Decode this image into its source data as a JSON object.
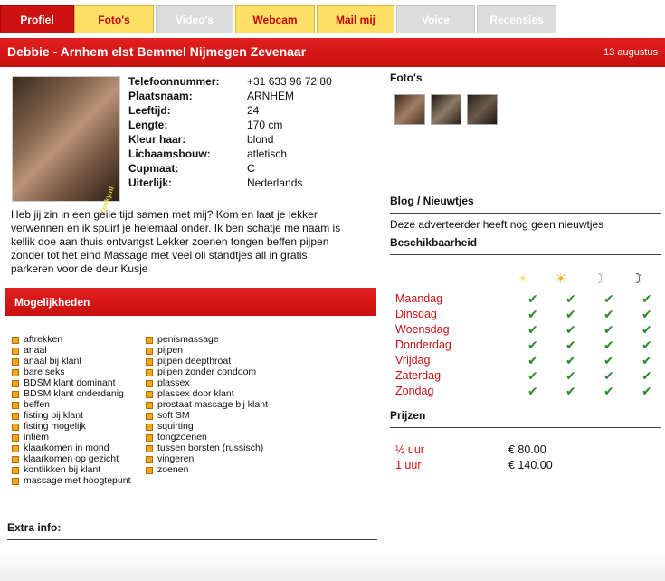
{
  "tabs": [
    {
      "label": "Profiel",
      "state": "active"
    },
    {
      "label": "Foto's",
      "state": "enabled"
    },
    {
      "label": "Video's",
      "state": "disabled"
    },
    {
      "label": "Webcam",
      "state": "enabled"
    },
    {
      "label": "Mail mij",
      "state": "enabled"
    },
    {
      "label": "Voice",
      "state": "disabled"
    },
    {
      "label": "Recensies",
      "state": "disabled"
    }
  ],
  "header": {
    "title": "Debbie - Arnhem elst Bemmel Nijmegen Zevenaar",
    "date": "13 augustus"
  },
  "photo": {
    "watermark": "Zoeky.nl"
  },
  "details": [
    {
      "label": "Telefoonnummer:",
      "value": "+31 633 96 72 80"
    },
    {
      "label": "Plaatsnaam:",
      "value": "ARNHEM"
    },
    {
      "label": "Leeftijd:",
      "value": "24"
    },
    {
      "label": "Lengte:",
      "value": "170 cm"
    },
    {
      "label": "Kleur haar:",
      "value": "blond"
    },
    {
      "label": "Lichaamsbouw:",
      "value": "atletisch"
    },
    {
      "label": "Cupmaat:",
      "value": "C"
    },
    {
      "label": "Uiterlijk:",
      "value": "Nederlands"
    }
  ],
  "intro": "Heb jij zin in een geile tijd samen met mij? Kom en laat je lekker verwennen en ik spuirt je helemaal onder. Ik ben schatje me naam is kellik doe aan thuis ontvangst Lekker zoenen tongen beffen pijpen zonder tot het eind Massage met veel oli standtjes all in gratis parkeren voor de deur Kusje",
  "options": {
    "title": "Mogelijkheden",
    "col1": [
      "aftrekken",
      "anaal",
      "anaal bij klant",
      "bare seks",
      "BDSM klant dominant",
      "BDSM klant onderdanig",
      "beffen",
      "fisting bij klant",
      "fisting mogelijk",
      "intiem",
      "klaarkomen in mond",
      "klaarkomen op gezicht",
      "kontlikken bij klant",
      "massage met hoogtepunt"
    ],
    "col2": [
      "penismassage",
      "pijpen",
      "pijpen deepthroat",
      "pijpen zonder condoom",
      "plassex",
      "plassex door klant",
      "prostaat massage bij klant",
      "soft SM",
      "squirting",
      "tongzoenen",
      "tussen borsten (russisch)",
      "vingeren",
      "zoenen"
    ]
  },
  "extra": {
    "title": "Extra info:"
  },
  "photos_section": {
    "title": "Foto's",
    "thumbnails": 3
  },
  "blog": {
    "title": "Blog / Nieuwtjes",
    "text": "Deze adverteerder heeft nog geen nieuwtjes"
  },
  "availability": {
    "title": "Beschikbaarheid",
    "icons": [
      "morning-sun-icon",
      "afternoon-sun-icon",
      "evening-moon-icon",
      "night-moon-icon"
    ],
    "days": [
      "Maandag",
      "Dinsdag",
      "Woensdag",
      "Donderdag",
      "Vrijdag",
      "Zaterdag",
      "Zondag"
    ],
    "available_all": true
  },
  "prices": {
    "title": "Prijzen",
    "rows": [
      {
        "duration": "½  uur",
        "price": "€ 80.00"
      },
      {
        "duration": "1   uur",
        "price": "€ 140.00"
      }
    ]
  },
  "colors": {
    "accent": "#cc1111",
    "tab_yellow": "#ffe066",
    "tab_disabled": "#dcdcdc",
    "check": "#2c8a2c",
    "bullet": "#f2a81d"
  }
}
